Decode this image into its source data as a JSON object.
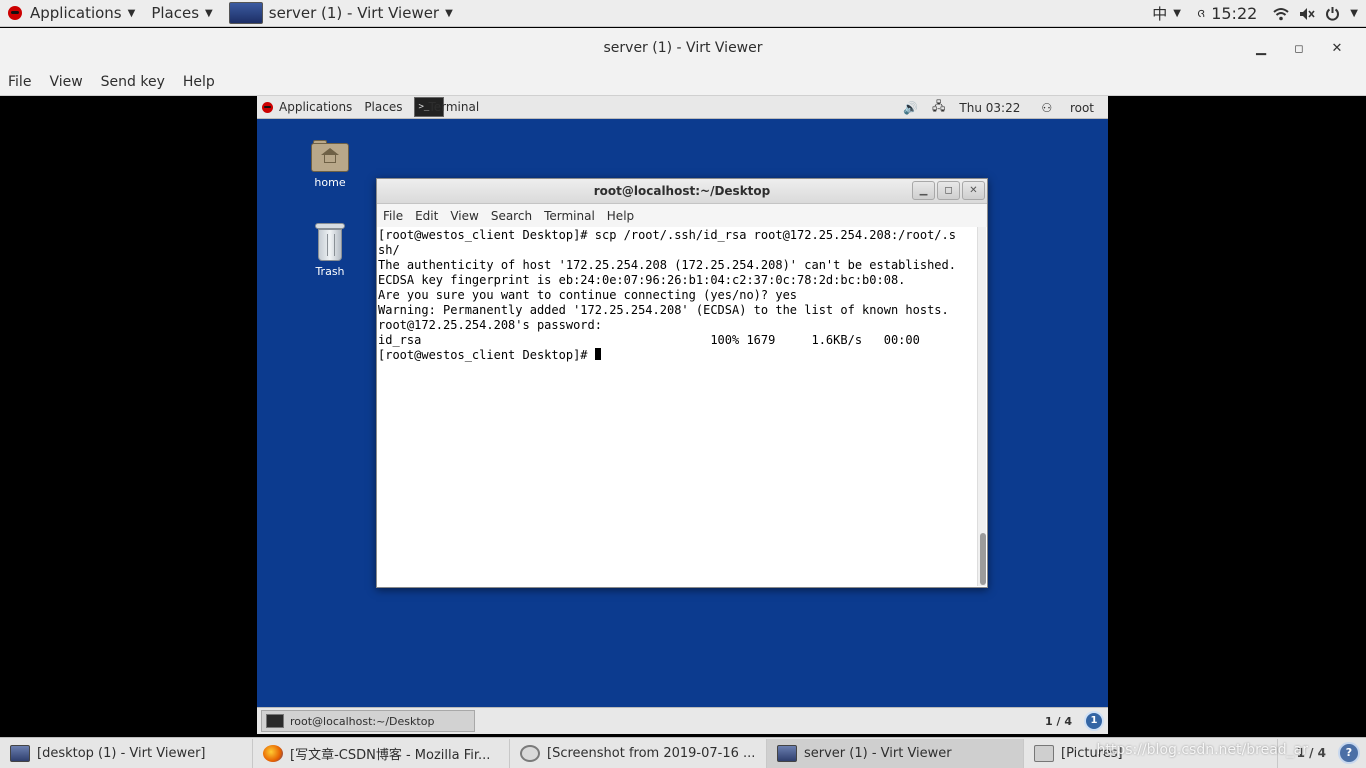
{
  "host_panel": {
    "applications": "Applications",
    "places": "Places",
    "window_title": "server (1) - Virt Viewer",
    "input_method": "中",
    "lang_glyph": "ᨩ",
    "time": "15:22"
  },
  "viewer": {
    "title": "server (1) - Virt Viewer",
    "menu": [
      "File",
      "View",
      "Send key",
      "Help"
    ]
  },
  "guest_panel": {
    "applications": "Applications",
    "places": "Places",
    "terminal": "Terminal",
    "clock": "Thu 03:22",
    "user": "root",
    "term_icon_text": ">_"
  },
  "desktop_icons": [
    {
      "label": "home"
    },
    {
      "label": "Trash"
    }
  ],
  "terminal": {
    "title": "root@localhost:~/Desktop",
    "menu": [
      "File",
      "Edit",
      "View",
      "Search",
      "Terminal",
      "Help"
    ],
    "lines": [
      "[root@westos_client Desktop]# scp /root/.ssh/id_rsa root@172.25.254.208:/root/.s",
      "sh/",
      "The authenticity of host '172.25.254.208 (172.25.254.208)' can't be established.",
      "ECDSA key fingerprint is eb:24:0e:07:96:26:b1:04:c2:37:0c:78:2d:bc:b0:08.",
      "Are you sure you want to continue connecting (yes/no)? yes",
      "Warning: Permanently added '172.25.254.208' (ECDSA) to the list of known hosts.",
      "root@172.25.254.208's password: ",
      "id_rsa                                        100% 1679     1.6KB/s   00:00",
      "[root@westos_client Desktop]# "
    ]
  },
  "guest_taskbar": {
    "task": "root@localhost:~/Desktop",
    "pager": "1 / 4",
    "badge": "1"
  },
  "host_taskbar": {
    "items": [
      {
        "label": "[desktop (1) - Virt Viewer]",
        "icon": "monitor-icon"
      },
      {
        "label": "[写文章-CSDN博客 - Mozilla Fir...",
        "icon": "firefox-icon"
      },
      {
        "label": "[Screenshot from 2019-07-16 ...",
        "icon": "screenshot-icon"
      },
      {
        "label": "server (1) - Virt Viewer",
        "icon": "monitor-icon"
      },
      {
        "label": "[Pictures]",
        "icon": "files-icon"
      }
    ],
    "pager": "1 / 4",
    "watermark": "https://blog.csdn.net/bread_ar"
  },
  "colors": {
    "guest_desktop": "#0c3b8f",
    "redhat": "#cc0000"
  }
}
